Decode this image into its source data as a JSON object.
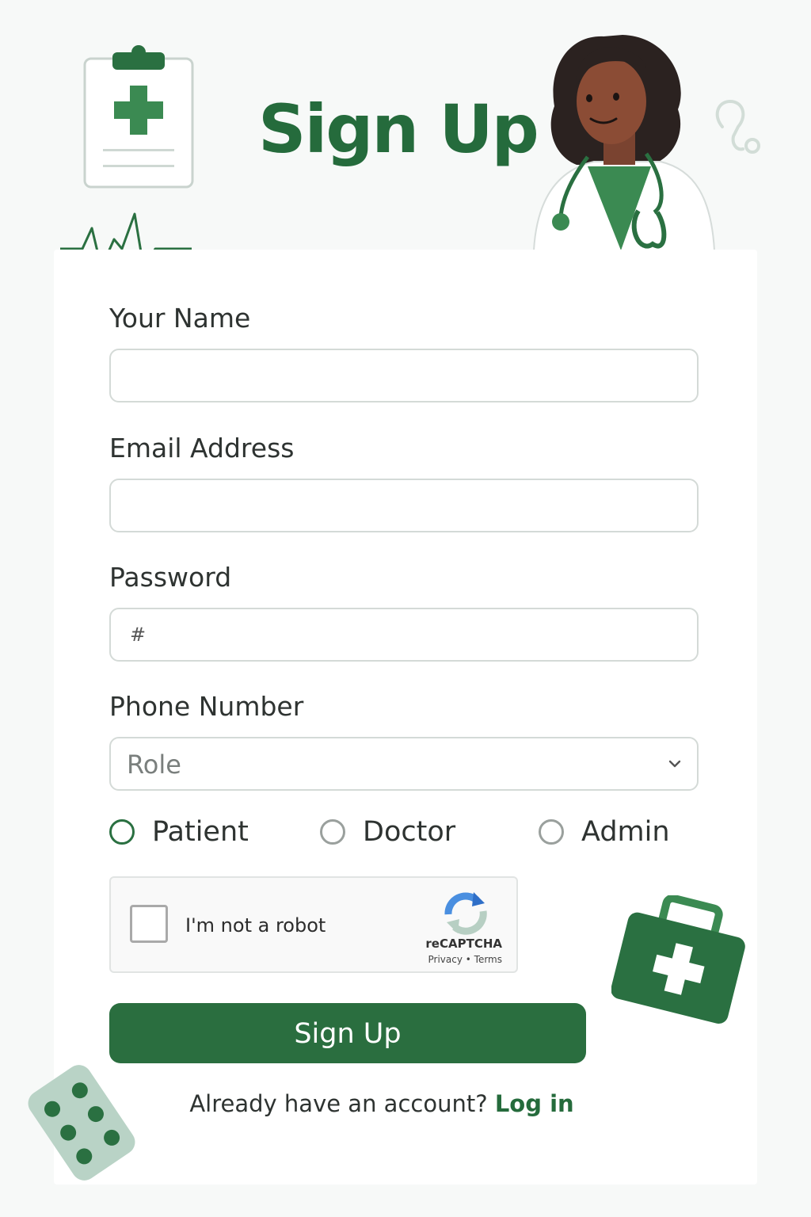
{
  "header": {
    "title": "Sign Up"
  },
  "form": {
    "name_label": "Your Name",
    "email_label": "Email Address",
    "password_label": "Password",
    "password_value": "#",
    "phone_label": "Phone Number",
    "role_placeholder": "Role",
    "roles": [
      {
        "label": "Patient",
        "selected": true
      },
      {
        "label": "Doctor",
        "selected": false
      },
      {
        "label": "Admin",
        "selected": false
      }
    ],
    "submit_label": "Sign Up"
  },
  "captcha": {
    "label": "I'm not a robot",
    "brand": "reCAPTCHA",
    "links": "Privacy • Terms"
  },
  "footer": {
    "prompt": "Already have an account?",
    "login_link": "Log in"
  },
  "colors": {
    "brand_green": "#256b3c",
    "button_green": "#2a6e3f",
    "background": "#f7f9f8"
  },
  "icons": [
    "clipboard-medical-icon",
    "heartbeat-icon",
    "doctor-illustration",
    "stethoscope-icon",
    "medical-kit-icon",
    "pill-pack-icon",
    "recaptcha-logo-icon",
    "chevron-down-icon"
  ]
}
